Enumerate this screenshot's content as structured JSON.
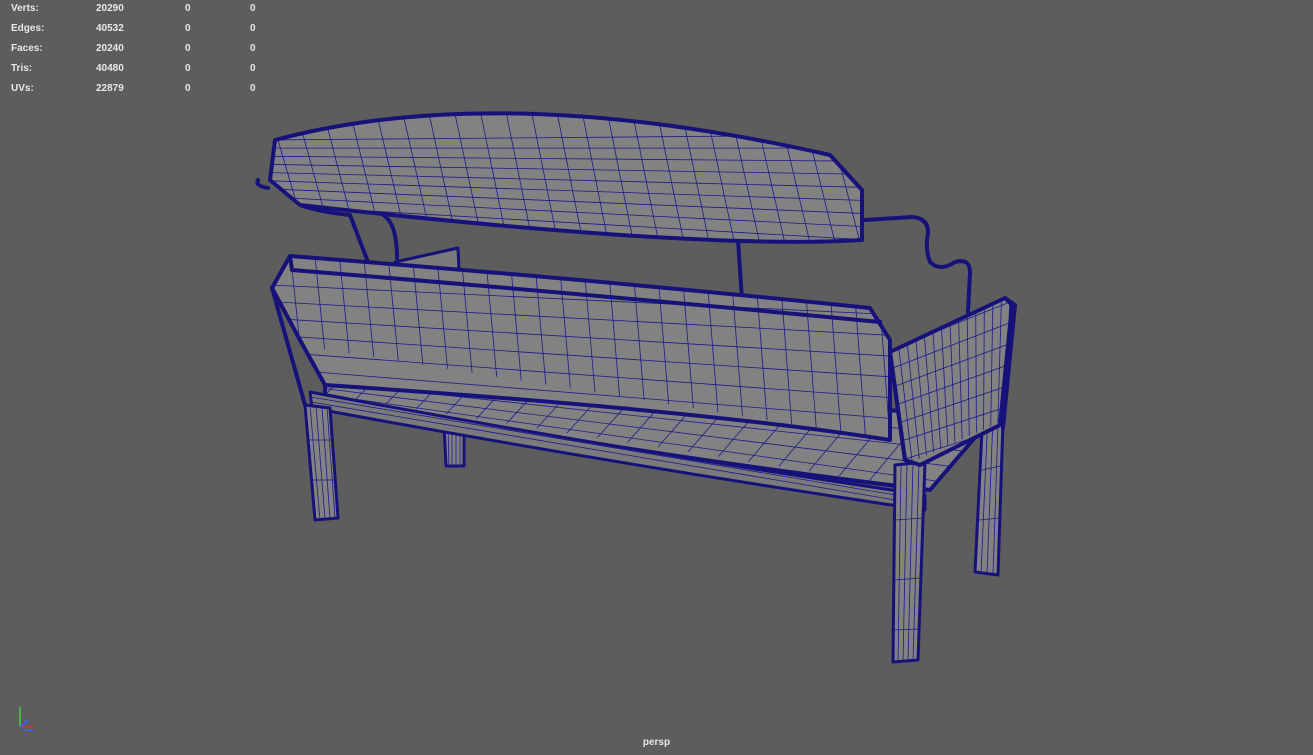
{
  "hud": {
    "rows": [
      {
        "label": "Verts:",
        "v1": "20290",
        "v2": "0",
        "v3": "0"
      },
      {
        "label": "Edges:",
        "v1": "40532",
        "v2": "0",
        "v3": "0"
      },
      {
        "label": "Faces:",
        "v1": "20240",
        "v2": "0",
        "v3": "0"
      },
      {
        "label": "Tris:",
        "v1": "40480",
        "v2": "0",
        "v3": "0"
      },
      {
        "label": "UVs:",
        "v1": "22879",
        "v2": "0",
        "v3": "0"
      }
    ]
  },
  "viewport": {
    "camera": "persp",
    "background_color": "#5d5d5d",
    "wireframe_color": "#16127a",
    "model": "bench-wireframe-mesh"
  },
  "axis_gizmo": {
    "icon": "xyz-axis-icon",
    "x_color": "#e03030",
    "y_color": "#40d040",
    "z_color": "#4060ff"
  }
}
